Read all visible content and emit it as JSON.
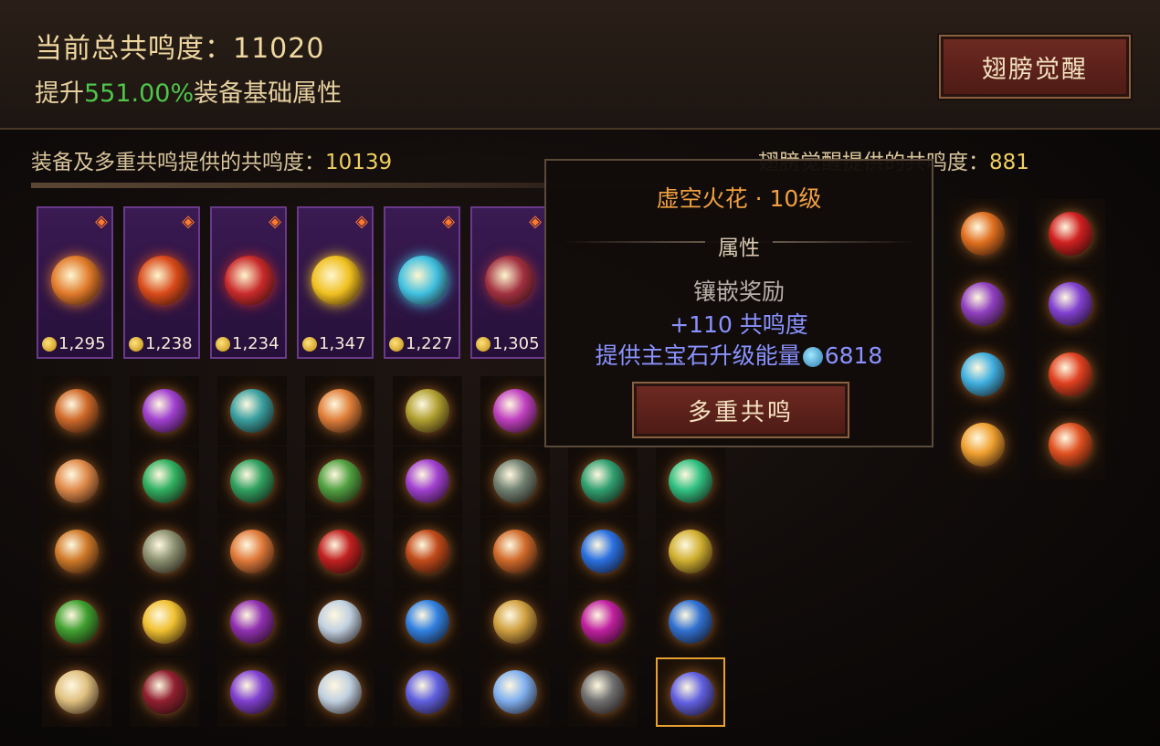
{
  "header": {
    "total_label": "当前总共鸣度：11020",
    "boost_prefix": "提升",
    "boost_value": "551.00%",
    "boost_suffix": "装备基础属性",
    "awaken_button": "翅膀觉醒"
  },
  "subheader": {
    "equip_label": "装备及多重共鸣提供的共鸣度：",
    "equip_value": "10139",
    "wing_label": "翅膀觉醒提供的共鸣度：",
    "wing_value": "881"
  },
  "equipment": [
    {
      "value": "1,295",
      "gem_color": "#e07a2a"
    },
    {
      "value": "1,238",
      "gem_color": "#d84a1a"
    },
    {
      "value": "1,234",
      "gem_color": "#c82a2a"
    },
    {
      "value": "1,347",
      "gem_color": "#f0c020"
    },
    {
      "value": "1,227",
      "gem_color": "#40c0e0"
    },
    {
      "value": "1,305",
      "gem_color": "#a03040"
    }
  ],
  "gems_left": [
    [
      "#d06a2a",
      "#a040d0",
      "#3aa0a0",
      "#e0803a",
      "#b0a030",
      "#c040c0"
    ],
    [
      "#e08a4a",
      "#30b060",
      "#30a060",
      "#50a040",
      "#a040d0",
      "#708070",
      "#30a070",
      "#30c080"
    ],
    [
      "#d07a2a",
      "#8a9070",
      "#e07a3a",
      "#c02020",
      "#c04a1a",
      "#d06a2a",
      "#2a70e0",
      "#d0b030"
    ],
    [
      "#40a030",
      "#f0c030",
      "#9030b0",
      "#c0d0e0",
      "#3080e0",
      "#d0a040",
      "#c020a0",
      "#3070d0"
    ],
    [
      "#e0c080",
      "#902030",
      "#8040d0",
      "#c0d0e0",
      "#6060e0",
      "#80b0f0",
      "#707070",
      "#6060e0"
    ]
  ],
  "gems_right": [
    [
      "#e07020",
      "#d02020"
    ],
    [
      "#9040c0",
      "#8040d0"
    ],
    [
      "#40b0e0",
      "#e04020"
    ],
    [
      "#f0a030",
      "#e05020"
    ]
  ],
  "tooltip": {
    "title": "虚空火花 · 10级",
    "prop_header": "属性",
    "bonus_label": "镶嵌奖励",
    "stat": "+110 共鸣度",
    "energy_prefix": "提供主宝石升级能量",
    "energy_value": "6818",
    "button": "多重共鸣"
  },
  "colors": {
    "accent_green": "#4ec64a",
    "accent_gold": "#f0d060",
    "tooltip_title": "#f0a040",
    "stat_blue": "#8a92ff"
  }
}
